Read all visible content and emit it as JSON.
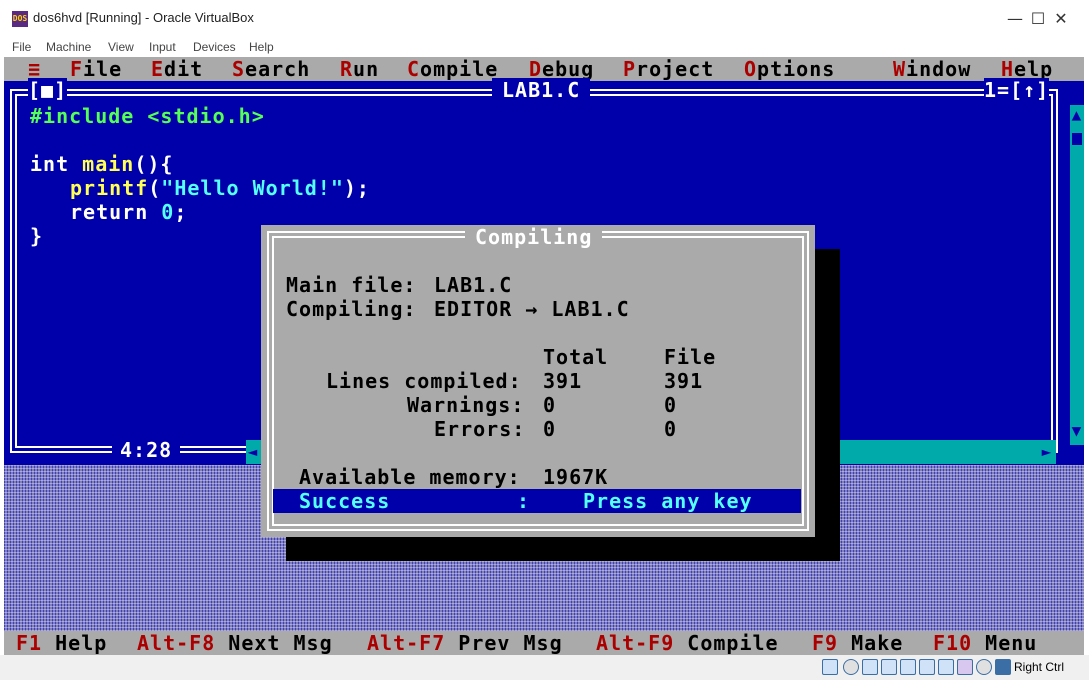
{
  "window": {
    "title": "dos6hvd [Running] - Oracle VirtualBox",
    "icon_label": "DOS",
    "minimize_glyph": "—",
    "maximize_glyph": "☐",
    "close_glyph": "✕",
    "menu": [
      "File",
      "Machine",
      "View",
      "Input",
      "Devices",
      "Help"
    ]
  },
  "tc_menu": {
    "system": "≡",
    "items": [
      {
        "hotkey": "F",
        "rest": "ile"
      },
      {
        "hotkey": "E",
        "rest": "dit"
      },
      {
        "hotkey": "S",
        "rest": "earch"
      },
      {
        "hotkey": "R",
        "rest": "un"
      },
      {
        "hotkey": "C",
        "rest": "ompile"
      },
      {
        "hotkey": "D",
        "rest": "ebug"
      },
      {
        "hotkey": "P",
        "rest": "roject"
      },
      {
        "hotkey": "O",
        "rest": "ptions"
      },
      {
        "hotkey": "W",
        "rest": "indow"
      },
      {
        "hotkey": "H",
        "rest": "elp"
      }
    ]
  },
  "editor": {
    "close_box": "[■]",
    "filename": "LAB1.C",
    "window_number": "1=[↑]",
    "cursor_position": "4:28",
    "code": {
      "line1": "#include <stdio.h>",
      "line3_kw": "int ",
      "line3_fn": "main",
      "line3_rest": "(){",
      "line4_fn": "printf",
      "line4_open": "(",
      "line4_str": "\"Hello World!\"",
      "line4_close": ");",
      "line5_kw": "return ",
      "line5_num": "0",
      "line5_end": ";",
      "line6": "}"
    }
  },
  "dialog": {
    "title": "Compiling",
    "main_file_label": "Main file:",
    "main_file_value": "LAB1.C",
    "compiling_label": "Compiling:",
    "compiling_value": "EDITOR → LAB1.C",
    "col_total": "Total",
    "col_file": "File",
    "lines_label": "Lines compiled:",
    "lines_total": "391",
    "lines_file": "391",
    "warnings_label": "Warnings:",
    "warnings_total": "0",
    "warnings_file": "0",
    "errors_label": "Errors:",
    "errors_total": "0",
    "errors_file": "0",
    "memory_label": "Available memory:",
    "memory_value": "1967K",
    "status_result": "Success",
    "status_sep": ":",
    "status_prompt": "Press any key"
  },
  "tc_status": [
    {
      "key": "F1",
      "label": " Help"
    },
    {
      "key": "Alt-F8",
      "label": " Next Msg"
    },
    {
      "key": "Alt-F7",
      "label": " Prev Msg"
    },
    {
      "key": "Alt-F9",
      "label": " Compile"
    },
    {
      "key": "F9",
      "label": " Make"
    },
    {
      "key": "F10",
      "label": " Menu"
    }
  ],
  "vbox_status": {
    "host_key": "Right Ctrl"
  }
}
